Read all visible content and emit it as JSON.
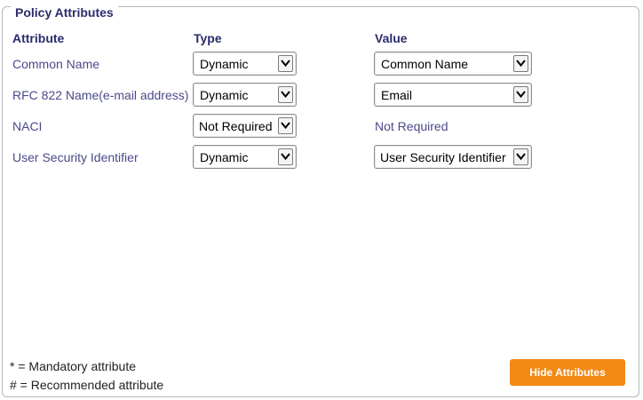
{
  "fieldset": {
    "legend": "Policy Attributes"
  },
  "headers": {
    "attribute": "Attribute",
    "type": "Type",
    "value": "Value"
  },
  "rows": [
    {
      "attribute": "Common Name",
      "type": "Dynamic",
      "value": "Common Name",
      "value_is_select": true
    },
    {
      "attribute": "RFC 822 Name(e-mail address)",
      "type": "Dynamic",
      "value": "Email",
      "value_is_select": true
    },
    {
      "attribute": "NACI",
      "type": "Not Required",
      "value": "Not Required",
      "value_is_select": false
    },
    {
      "attribute": "User Security Identifier",
      "type": "Dynamic",
      "value": "User Security Identifier",
      "value_is_select": true
    }
  ],
  "notes": {
    "mandatory": "* = Mandatory attribute",
    "recommended": "# = Recommended attribute"
  },
  "button": {
    "label": "Hide Attributes",
    "color": "#f28a14"
  },
  "icons": {
    "dropdown": "chevron-down-icon"
  }
}
